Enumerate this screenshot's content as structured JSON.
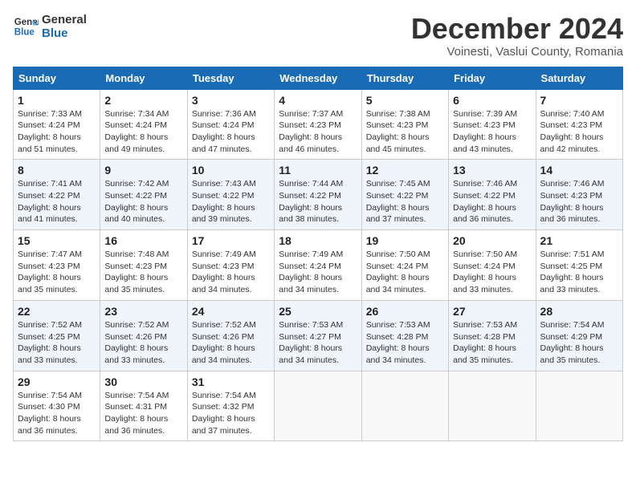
{
  "header": {
    "logo_line1": "General",
    "logo_line2": "Blue",
    "month_title": "December 2024",
    "subtitle": "Voinesti, Vaslui County, Romania"
  },
  "weekdays": [
    "Sunday",
    "Monday",
    "Tuesday",
    "Wednesday",
    "Thursday",
    "Friday",
    "Saturday"
  ],
  "weeks": [
    [
      {
        "day": "1",
        "info": "Sunrise: 7:33 AM\nSunset: 4:24 PM\nDaylight: 8 hours\nand 51 minutes."
      },
      {
        "day": "2",
        "info": "Sunrise: 7:34 AM\nSunset: 4:24 PM\nDaylight: 8 hours\nand 49 minutes."
      },
      {
        "day": "3",
        "info": "Sunrise: 7:36 AM\nSunset: 4:24 PM\nDaylight: 8 hours\nand 47 minutes."
      },
      {
        "day": "4",
        "info": "Sunrise: 7:37 AM\nSunset: 4:23 PM\nDaylight: 8 hours\nand 46 minutes."
      },
      {
        "day": "5",
        "info": "Sunrise: 7:38 AM\nSunset: 4:23 PM\nDaylight: 8 hours\nand 45 minutes."
      },
      {
        "day": "6",
        "info": "Sunrise: 7:39 AM\nSunset: 4:23 PM\nDaylight: 8 hours\nand 43 minutes."
      },
      {
        "day": "7",
        "info": "Sunrise: 7:40 AM\nSunset: 4:23 PM\nDaylight: 8 hours\nand 42 minutes."
      }
    ],
    [
      {
        "day": "8",
        "info": "Sunrise: 7:41 AM\nSunset: 4:22 PM\nDaylight: 8 hours\nand 41 minutes."
      },
      {
        "day": "9",
        "info": "Sunrise: 7:42 AM\nSunset: 4:22 PM\nDaylight: 8 hours\nand 40 minutes."
      },
      {
        "day": "10",
        "info": "Sunrise: 7:43 AM\nSunset: 4:22 PM\nDaylight: 8 hours\nand 39 minutes."
      },
      {
        "day": "11",
        "info": "Sunrise: 7:44 AM\nSunset: 4:22 PM\nDaylight: 8 hours\nand 38 minutes."
      },
      {
        "day": "12",
        "info": "Sunrise: 7:45 AM\nSunset: 4:22 PM\nDaylight: 8 hours\nand 37 minutes."
      },
      {
        "day": "13",
        "info": "Sunrise: 7:46 AM\nSunset: 4:22 PM\nDaylight: 8 hours\nand 36 minutes."
      },
      {
        "day": "14",
        "info": "Sunrise: 7:46 AM\nSunset: 4:23 PM\nDaylight: 8 hours\nand 36 minutes."
      }
    ],
    [
      {
        "day": "15",
        "info": "Sunrise: 7:47 AM\nSunset: 4:23 PM\nDaylight: 8 hours\nand 35 minutes."
      },
      {
        "day": "16",
        "info": "Sunrise: 7:48 AM\nSunset: 4:23 PM\nDaylight: 8 hours\nand 35 minutes."
      },
      {
        "day": "17",
        "info": "Sunrise: 7:49 AM\nSunset: 4:23 PM\nDaylight: 8 hours\nand 34 minutes."
      },
      {
        "day": "18",
        "info": "Sunrise: 7:49 AM\nSunset: 4:24 PM\nDaylight: 8 hours\nand 34 minutes."
      },
      {
        "day": "19",
        "info": "Sunrise: 7:50 AM\nSunset: 4:24 PM\nDaylight: 8 hours\nand 34 minutes."
      },
      {
        "day": "20",
        "info": "Sunrise: 7:50 AM\nSunset: 4:24 PM\nDaylight: 8 hours\nand 33 minutes."
      },
      {
        "day": "21",
        "info": "Sunrise: 7:51 AM\nSunset: 4:25 PM\nDaylight: 8 hours\nand 33 minutes."
      }
    ],
    [
      {
        "day": "22",
        "info": "Sunrise: 7:52 AM\nSunset: 4:25 PM\nDaylight: 8 hours\nand 33 minutes."
      },
      {
        "day": "23",
        "info": "Sunrise: 7:52 AM\nSunset: 4:26 PM\nDaylight: 8 hours\nand 33 minutes."
      },
      {
        "day": "24",
        "info": "Sunrise: 7:52 AM\nSunset: 4:26 PM\nDaylight: 8 hours\nand 34 minutes."
      },
      {
        "day": "25",
        "info": "Sunrise: 7:53 AM\nSunset: 4:27 PM\nDaylight: 8 hours\nand 34 minutes."
      },
      {
        "day": "26",
        "info": "Sunrise: 7:53 AM\nSunset: 4:28 PM\nDaylight: 8 hours\nand 34 minutes."
      },
      {
        "day": "27",
        "info": "Sunrise: 7:53 AM\nSunset: 4:28 PM\nDaylight: 8 hours\nand 35 minutes."
      },
      {
        "day": "28",
        "info": "Sunrise: 7:54 AM\nSunset: 4:29 PM\nDaylight: 8 hours\nand 35 minutes."
      }
    ],
    [
      {
        "day": "29",
        "info": "Sunrise: 7:54 AM\nSunset: 4:30 PM\nDaylight: 8 hours\nand 36 minutes."
      },
      {
        "day": "30",
        "info": "Sunrise: 7:54 AM\nSunset: 4:31 PM\nDaylight: 8 hours\nand 36 minutes."
      },
      {
        "day": "31",
        "info": "Sunrise: 7:54 AM\nSunset: 4:32 PM\nDaylight: 8 hours\nand 37 minutes."
      },
      null,
      null,
      null,
      null
    ]
  ]
}
